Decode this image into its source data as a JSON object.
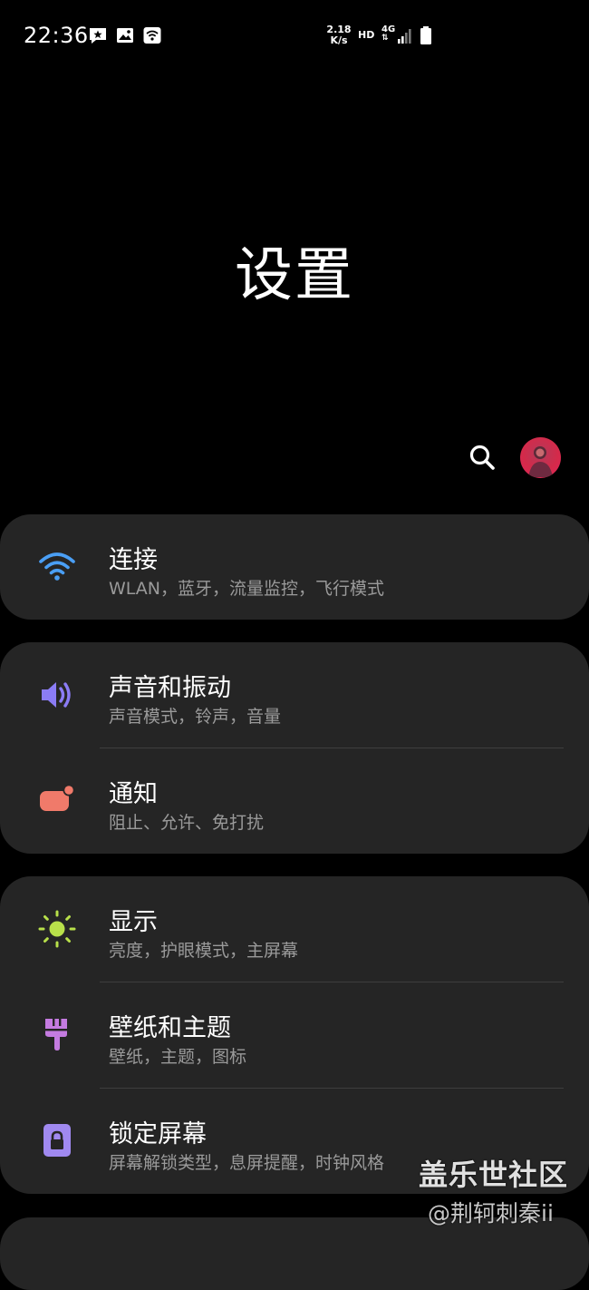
{
  "status_bar": {
    "time": "22:36",
    "net_speed_value": "2.18",
    "net_speed_unit": "K/s",
    "hd": "HD",
    "network_type": "4G"
  },
  "header": {
    "title": "设置"
  },
  "menu": [
    {
      "title": "连接",
      "subtitle": "WLAN，蓝牙，流量监控，飞行模式",
      "icon": "wifi-icon",
      "color": "#4a9ff5"
    },
    {
      "title": "声音和振动",
      "subtitle": "声音模式，铃声，音量",
      "icon": "speaker-icon",
      "color": "#8b7cf5"
    },
    {
      "title": "通知",
      "subtitle": "阻止、允许、免打扰",
      "icon": "notification-icon",
      "color": "#f07a6a"
    },
    {
      "title": "显示",
      "subtitle": "亮度，护眼模式，主屏幕",
      "icon": "brightness-icon",
      "color": "#b8e04a"
    },
    {
      "title": "壁纸和主题",
      "subtitle": "壁纸，主题，图标",
      "icon": "paintbrush-icon",
      "color": "#c47be0"
    },
    {
      "title": "锁定屏幕",
      "subtitle": "屏幕解锁类型，息屏提醒，时钟风格",
      "icon": "lock-icon",
      "color": "#a089f0"
    }
  ],
  "watermark": {
    "line1": "盖乐世社区",
    "line2": "@荆轲刺秦ii"
  },
  "colors": {
    "background": "#000000",
    "card": "#252525",
    "subtitle": "#9a9a9a"
  }
}
